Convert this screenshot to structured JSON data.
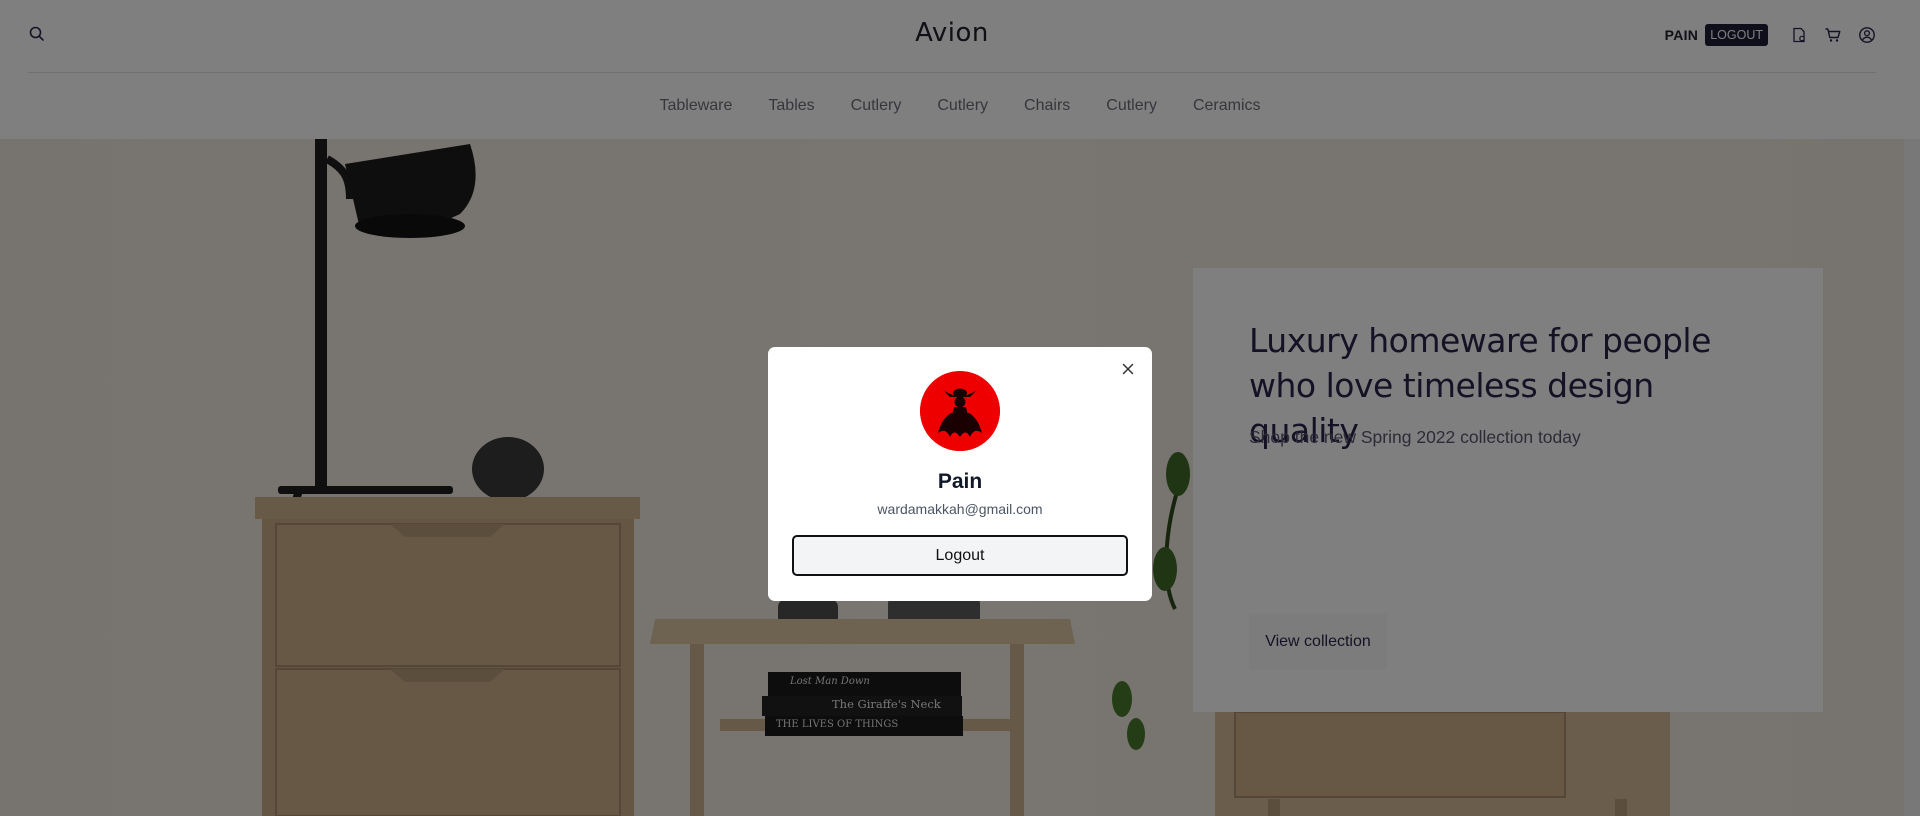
{
  "header": {
    "brand": "Avion",
    "user_name": "PAIN",
    "logout_label": "LOGOUT",
    "icons": [
      "search-icon",
      "profile-card-icon",
      "cart-icon",
      "user-circle-icon"
    ]
  },
  "nav": {
    "items": [
      "Tableware",
      "Tables",
      "Cutlery",
      "Cutlery",
      "Chairs",
      "Cutlery",
      "Ceramics"
    ]
  },
  "hero": {
    "title": "Luxury homeware for people who love timeless design quality",
    "subtitle": "Shop the new Spring 2022 collection today",
    "cta_label": "View collection",
    "book_titles": [
      "Lost Man Down",
      "The Giraffe's Neck",
      "THE LIVES OF THINGS"
    ]
  },
  "modal": {
    "name": "Pain",
    "email": "wardamakkah@gmail.com",
    "logout_label": "Logout",
    "avatar_color": "#ef0000"
  },
  "colors": {
    "primary": "#2a254b",
    "overlay": "rgba(0,0,0,0.5)",
    "logout_pill": "#1f1d36"
  }
}
